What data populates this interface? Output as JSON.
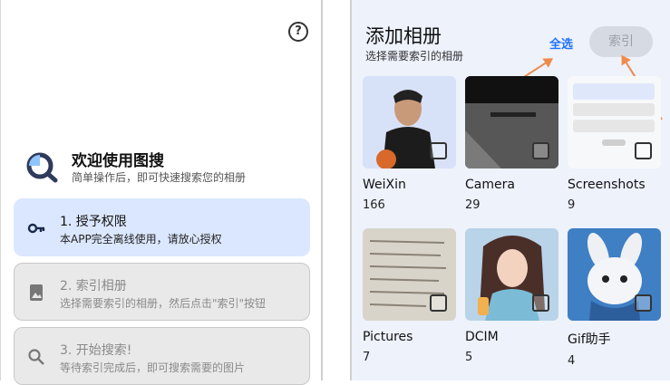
{
  "left": {
    "help_icon": "?",
    "welcome_title": "欢迎使用图搜",
    "welcome_subtitle": "简单操作后，即可快速搜索您的相册",
    "steps": [
      {
        "title": "1. 授予权限",
        "desc": "本APP完全离线使用，请放心授权",
        "icon": "key-icon"
      },
      {
        "title": "2. 索引相册",
        "desc": "选择需要索引的相册，然后点击\"索引\"按钮",
        "icon": "album-icon"
      },
      {
        "title": "3. 开始搜索!",
        "desc": "等待索引完成后，即可搜索需要的图片",
        "icon": "search-icon"
      }
    ]
  },
  "right": {
    "title": "添加相册",
    "subtitle": "选择需要索引的相册",
    "select_all": "全选",
    "index_button": "索引",
    "albums": [
      {
        "name": "WeiXin",
        "count": "166"
      },
      {
        "name": "Camera",
        "count": "29"
      },
      {
        "name": "Screenshots",
        "count": "9"
      },
      {
        "name": "Pictures",
        "count": "7"
      },
      {
        "name": "DCIM",
        "count": "5"
      },
      {
        "name": "Gif助手",
        "count": "4"
      }
    ]
  },
  "colors": {
    "accent": "#1f73ff",
    "active_step": "#dbe7fe",
    "arrow": "#f08a4b"
  }
}
